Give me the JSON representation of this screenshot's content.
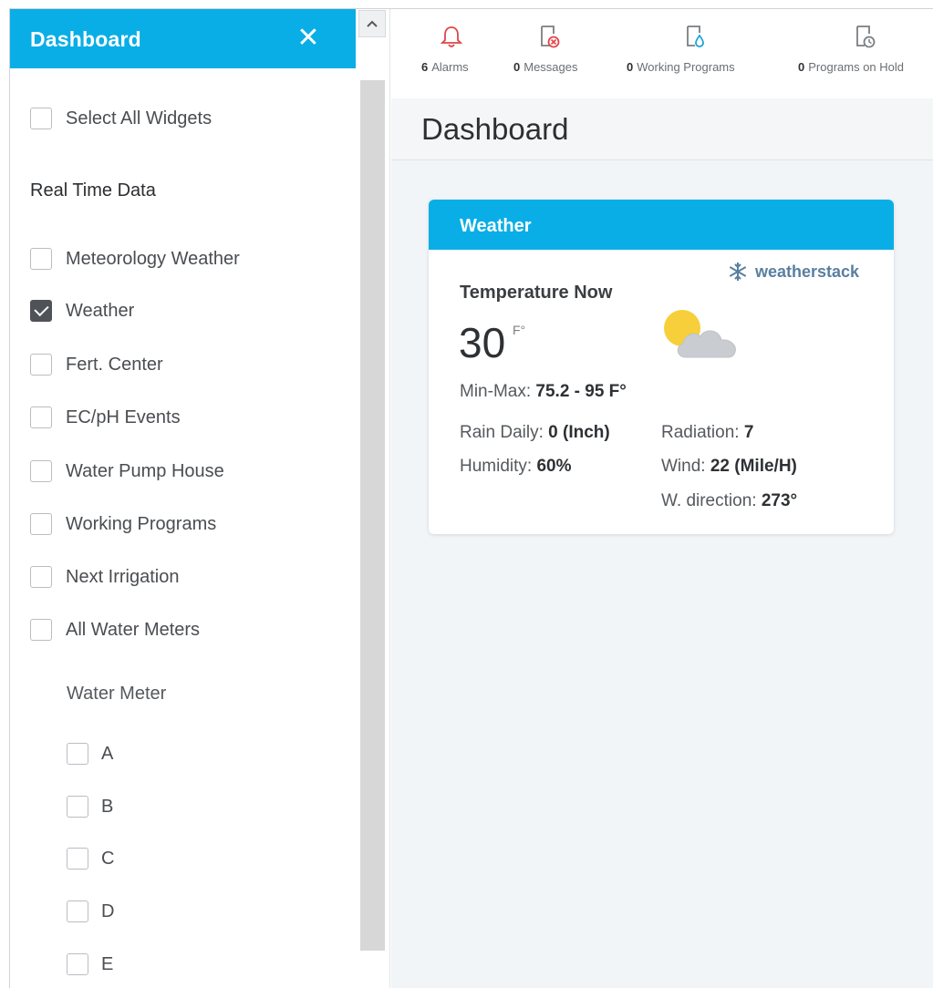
{
  "panel": {
    "title": "Dashboard",
    "close_icon": "close-icon",
    "select_all_label": "Select All Widgets",
    "section_title": "Real Time Data",
    "widgets": [
      {
        "label": "Meteorology Weather",
        "checked": false
      },
      {
        "label": "Weather",
        "checked": true
      },
      {
        "label": "Fert. Center",
        "checked": false
      },
      {
        "label": "EC/pH Events",
        "checked": false
      },
      {
        "label": "Water Pump House",
        "checked": false
      },
      {
        "label": "Working Programs",
        "checked": false
      },
      {
        "label": "Next Irrigation",
        "checked": false
      },
      {
        "label": "All Water Meters",
        "checked": false
      }
    ],
    "water_meter_title": "Water Meter",
    "water_meters": [
      {
        "label": "A",
        "checked": false
      },
      {
        "label": "B",
        "checked": false
      },
      {
        "label": "C",
        "checked": false
      },
      {
        "label": "D",
        "checked": false
      },
      {
        "label": "E",
        "checked": false
      }
    ]
  },
  "topbar": {
    "items": [
      {
        "icon": "bell-icon",
        "count": "6",
        "label": "Alarms",
        "color": "#e0454a"
      },
      {
        "icon": "message-cancel-icon",
        "count": "0",
        "label": "Messages",
        "color": "#e0454a"
      },
      {
        "icon": "program-drop-icon",
        "count": "0",
        "label": "Working Programs",
        "color": "#1ea4dc"
      },
      {
        "icon": "program-clock-icon",
        "count": "0",
        "label": "Programs on Hold",
        "color": "#7a7e82"
      }
    ]
  },
  "page": {
    "title": "Dashboard"
  },
  "weather": {
    "card_title": "Weather",
    "brand": "weatherstack",
    "temperature_label": "Temperature Now",
    "temperature": "30",
    "temperature_unit": "F°",
    "condition_icon": "partly-cloudy-icon",
    "min_max_label": "Min-Max:",
    "min_max_value": "75.2 - 95 F°",
    "rain_label": "Rain Daily:",
    "rain_value": "0 (Inch)",
    "radiation_label": "Radiation:",
    "radiation_value": "7",
    "humidity_label": "Humidity:",
    "humidity_value": "60%",
    "wind_label": "Wind:",
    "wind_value": "22 (Mile/H)",
    "direction_label": "W. direction:",
    "direction_value": "273°"
  },
  "colors": {
    "accent": "#09aee6",
    "alarm": "#e0454a",
    "background": "#f1f5f8"
  }
}
